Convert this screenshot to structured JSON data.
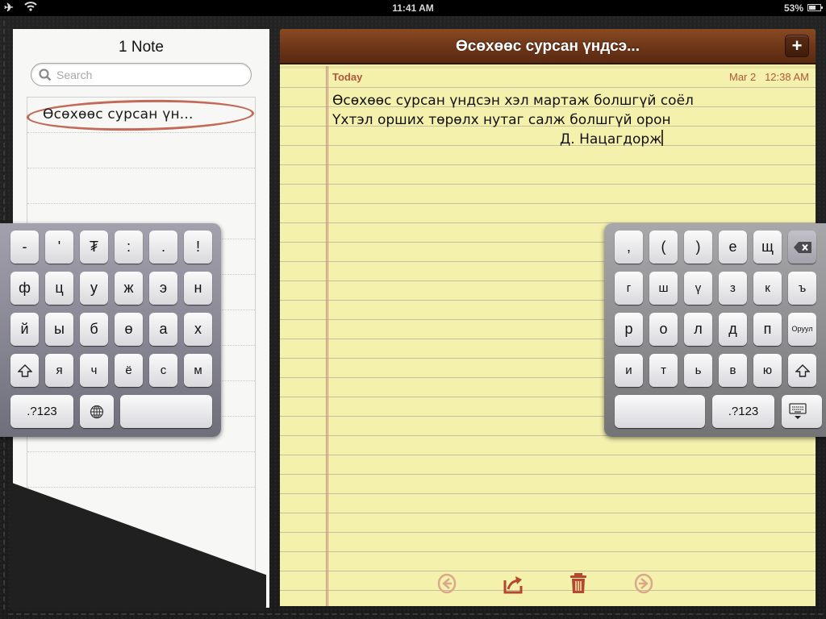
{
  "status_bar": {
    "time": "11:41 AM",
    "battery": "53%",
    "battery_level": 0.53,
    "airplane_icon": "airplane-icon",
    "wifi_icon": "wifi-icon"
  },
  "notes_list": {
    "title": "1 Note",
    "search_placeholder": "Search",
    "items": [
      {
        "label": "Өсөхөөс сурсан үн..."
      }
    ]
  },
  "note": {
    "title": "Өсөхөөс сурсан үндсэ...",
    "add_label": "+",
    "date_label": "Today",
    "date": "Mar 2",
    "time": "12:38 AM",
    "lines": [
      "Өсөхөөс сурсан үндсэн хэл мартаж болшгүй соёл",
      "Үхтэл орших төрөлх нутаг салж болшгүй орон",
      "Д. Нацагдорж"
    ],
    "toolbar": [
      "previous-note-icon",
      "share-icon",
      "trash-icon",
      "next-note-icon"
    ]
  },
  "keyboard_left": {
    "rows": [
      [
        "-",
        "'",
        "₮",
        ":",
        ".",
        "!"
      ],
      [
        "ф",
        "ц",
        "у",
        "ж",
        "э",
        "н"
      ],
      [
        "й",
        "ы",
        "б",
        "ө",
        "а",
        "х"
      ],
      [
        "shift",
        "я",
        "ч",
        "ё",
        "с",
        "м"
      ]
    ],
    "bottom": {
      "numbers": ".?123",
      "globe": "globe",
      "space": ""
    }
  },
  "keyboard_right": {
    "rows": [
      [
        ",",
        "(",
        ")",
        "е",
        "щ",
        "delete"
      ],
      [
        "г",
        "ш",
        "ү",
        "з",
        "к",
        "ъ"
      ],
      [
        "р",
        "о",
        "л",
        "д",
        "п",
        "Оруул"
      ],
      [
        "и",
        "т",
        "ь",
        "в",
        "ю",
        "shift"
      ]
    ],
    "bottom": {
      "space": "",
      "numbers": ".?123",
      "hide": "hide-keyboard"
    }
  }
}
